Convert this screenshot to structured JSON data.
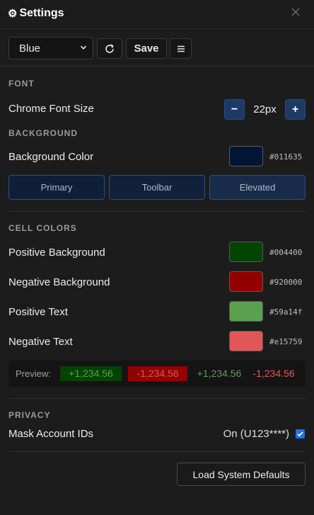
{
  "header": {
    "title": "Settings",
    "gear_icon": "gear-icon",
    "close_icon": "close-icon"
  },
  "toolbar": {
    "theme_select": {
      "value": "Blue",
      "options": [
        "Blue"
      ]
    },
    "refresh_icon": "refresh-icon",
    "save_label": "Save",
    "menu_icon": "menu-icon"
  },
  "font": {
    "section_label": "FONT",
    "chrome_font_size_label": "Chrome Font Size",
    "minus_label": "−",
    "plus_label": "+",
    "size_value": "22px"
  },
  "background": {
    "section_label": "BACKGROUND",
    "color_label": "Background Color",
    "color_value": "#011635",
    "presets": [
      "Primary",
      "Toolbar",
      "Elevated"
    ]
  },
  "cell_colors": {
    "section_label": "CELL COLORS",
    "positive_background": {
      "label": "Positive Background",
      "value": "#004400"
    },
    "negative_background": {
      "label": "Negative Background",
      "value": "#920000"
    },
    "positive_text": {
      "label": "Positive Text",
      "value": "#59a14f"
    },
    "negative_text": {
      "label": "Negative Text",
      "value": "#e15759"
    },
    "preview": {
      "label": "Preview:",
      "positive_bg_sample": "+1,234.56",
      "negative_bg_sample": "-1,234.56",
      "positive_text_sample": "+1,234.56",
      "negative_text_sample": "-1,234.56"
    }
  },
  "privacy": {
    "section_label": "PRIVACY",
    "mask_label": "Mask Account IDs",
    "mask_value": "On (U123****)",
    "mask_checked": true
  },
  "footer": {
    "load_defaults_label": "Load System Defaults"
  }
}
